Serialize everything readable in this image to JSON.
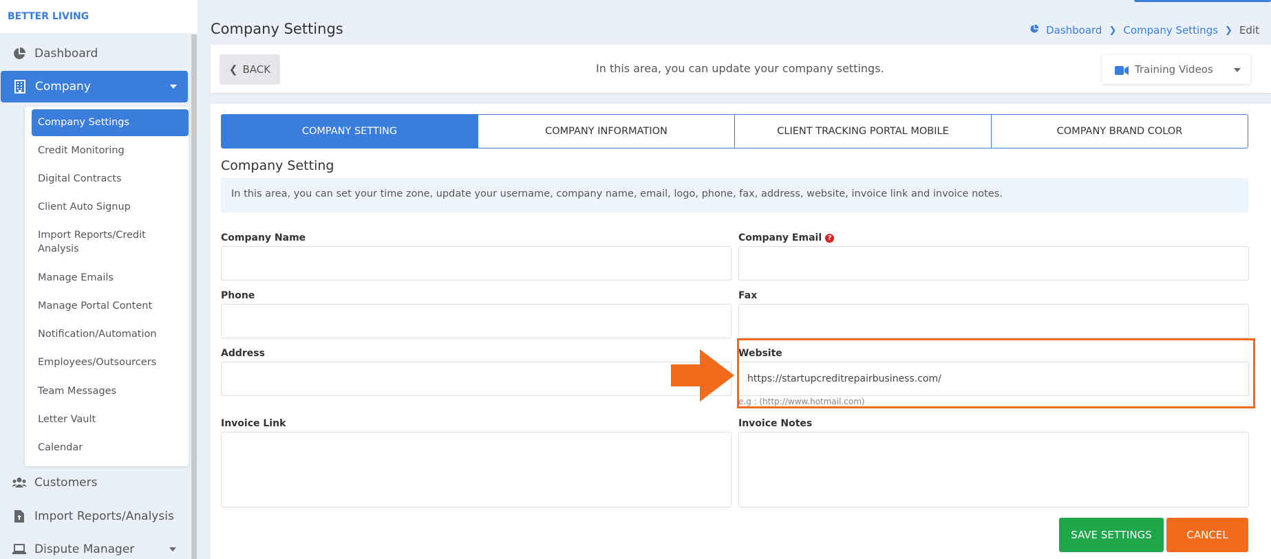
{
  "brand": "BETTER LIVING",
  "sidebar": {
    "items": [
      {
        "label": "Dashboard",
        "icon": "pie-chart-icon"
      },
      {
        "label": "Company",
        "icon": "building-icon"
      },
      {
        "label": "Customers",
        "icon": "users-icon"
      },
      {
        "label": "Import Reports/Analysis",
        "icon": "file-upload-icon"
      },
      {
        "label": "Dispute Manager",
        "icon": "laptop-icon"
      }
    ],
    "submenu": [
      "Company Settings",
      "Credit Monitoring",
      "Digital Contracts",
      "Client Auto Signup",
      "Import Reports/Credit Analysis",
      "Manage Emails",
      "Manage Portal Content",
      "Notification/Automation",
      "Employees/Outsourcers",
      "Team Messages",
      "Letter Vault",
      "Calendar"
    ]
  },
  "page": {
    "title": "Company Settings",
    "breadcrumb": [
      "Dashboard",
      "Company Settings",
      "Edit"
    ]
  },
  "topbar": {
    "back_label": "BACK",
    "message": "In this area, you can update your company settings.",
    "training_label": "Training Videos"
  },
  "tabs": [
    "COMPANY SETTING",
    "COMPANY INFORMATION",
    "CLIENT TRACKING PORTAL MOBILE",
    "COMPANY BRAND COLOR"
  ],
  "section": {
    "title": "Company Setting",
    "info": "In this area, you can set your time zone, update your username, company name, email, logo, phone, fax, address, website, invoice link and invoice notes."
  },
  "form": {
    "company_name": {
      "label": "Company Name",
      "value": ""
    },
    "company_email": {
      "label": "Company Email",
      "value": ""
    },
    "phone": {
      "label": "Phone",
      "value": ""
    },
    "fax": {
      "label": "Fax",
      "value": ""
    },
    "address": {
      "label": "Address",
      "value": ""
    },
    "website": {
      "label": "Website",
      "value": "https://startupcreditrepairbusiness.com/",
      "hint": "e.g : (http://www.hotmail.com)"
    },
    "invoice_link": {
      "label": "Invoice Link",
      "value": ""
    },
    "invoice_notes": {
      "label": "Invoice Notes",
      "value": ""
    }
  },
  "actions": {
    "save_label": "SAVE SETTINGS",
    "cancel_label": "CANCEL"
  },
  "colors": {
    "accent": "#3b7ddd",
    "save": "#1fa64a",
    "cancel": "#f26b1d",
    "highlight": "#f26b1d"
  }
}
